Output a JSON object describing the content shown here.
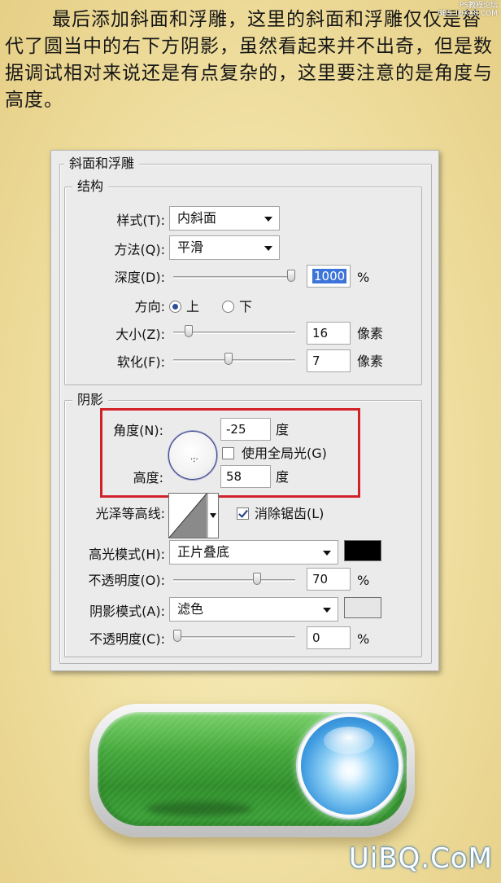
{
  "intro_text": "最后添加斜面和浮雕，这里的斜面和浮雕仅仅是替代了圆当中的右下方阴影，虽然看起来并不出奇，但是数据调试相对来说还是有点复杂的，这里要注意的是角度与高度。",
  "watermark": "PS教程论坛\nBBS.16XX8.COM",
  "dialog": {
    "title": "斜面和浮雕",
    "structure": {
      "legend": "结构",
      "style_label": "样式(T):",
      "style_value": "内斜面",
      "technique_label": "方法(Q):",
      "technique_value": "平滑",
      "depth_label": "深度(D):",
      "depth_value": "1000",
      "depth_unit": "%",
      "depth_slider": 1.0,
      "direction_label": "方向:",
      "direction_up": "上",
      "direction_down": "下",
      "direction_selected": "上",
      "size_label": "大小(Z):",
      "size_value": "16",
      "size_unit": "像素",
      "size_slider": 0.1,
      "soften_label": "软化(F):",
      "soften_value": "7",
      "soften_unit": "像素",
      "soften_slider": 0.45
    },
    "shading": {
      "legend": "阴影",
      "angle_label": "角度(N):",
      "angle_value": "-25",
      "angle_unit": "度",
      "global_light_label": "使用全局光(G)",
      "global_light_checked": false,
      "altitude_label": "高度:",
      "altitude_value": "58",
      "altitude_unit": "度",
      "gloss_contour_label": "光泽等高线:",
      "anti_aliased_label": "消除锯齿(L)",
      "anti_aliased_checked": true,
      "highlight_mode_label": "高光模式(H):",
      "highlight_mode_value": "正片叠底",
      "highlight_color": "#000000",
      "highlight_opacity_label": "不透明度(O):",
      "highlight_opacity_value": "70",
      "highlight_opacity_unit": "%",
      "highlight_opacity_slider": 0.7,
      "shadow_mode_label": "阴影模式(A):",
      "shadow_mode_value": "滤色",
      "shadow_color": "#e6e6e6",
      "shadow_opacity_label": "不透明度(C):",
      "shadow_opacity_value": "0",
      "shadow_opacity_unit": "%",
      "shadow_opacity_slider": 0.0
    }
  },
  "brand": "UiBQ.CoM",
  "colors": {
    "accent_box": "#d1222a",
    "button_green": "#3ea53a",
    "orb_blue": "#3f9be0"
  }
}
